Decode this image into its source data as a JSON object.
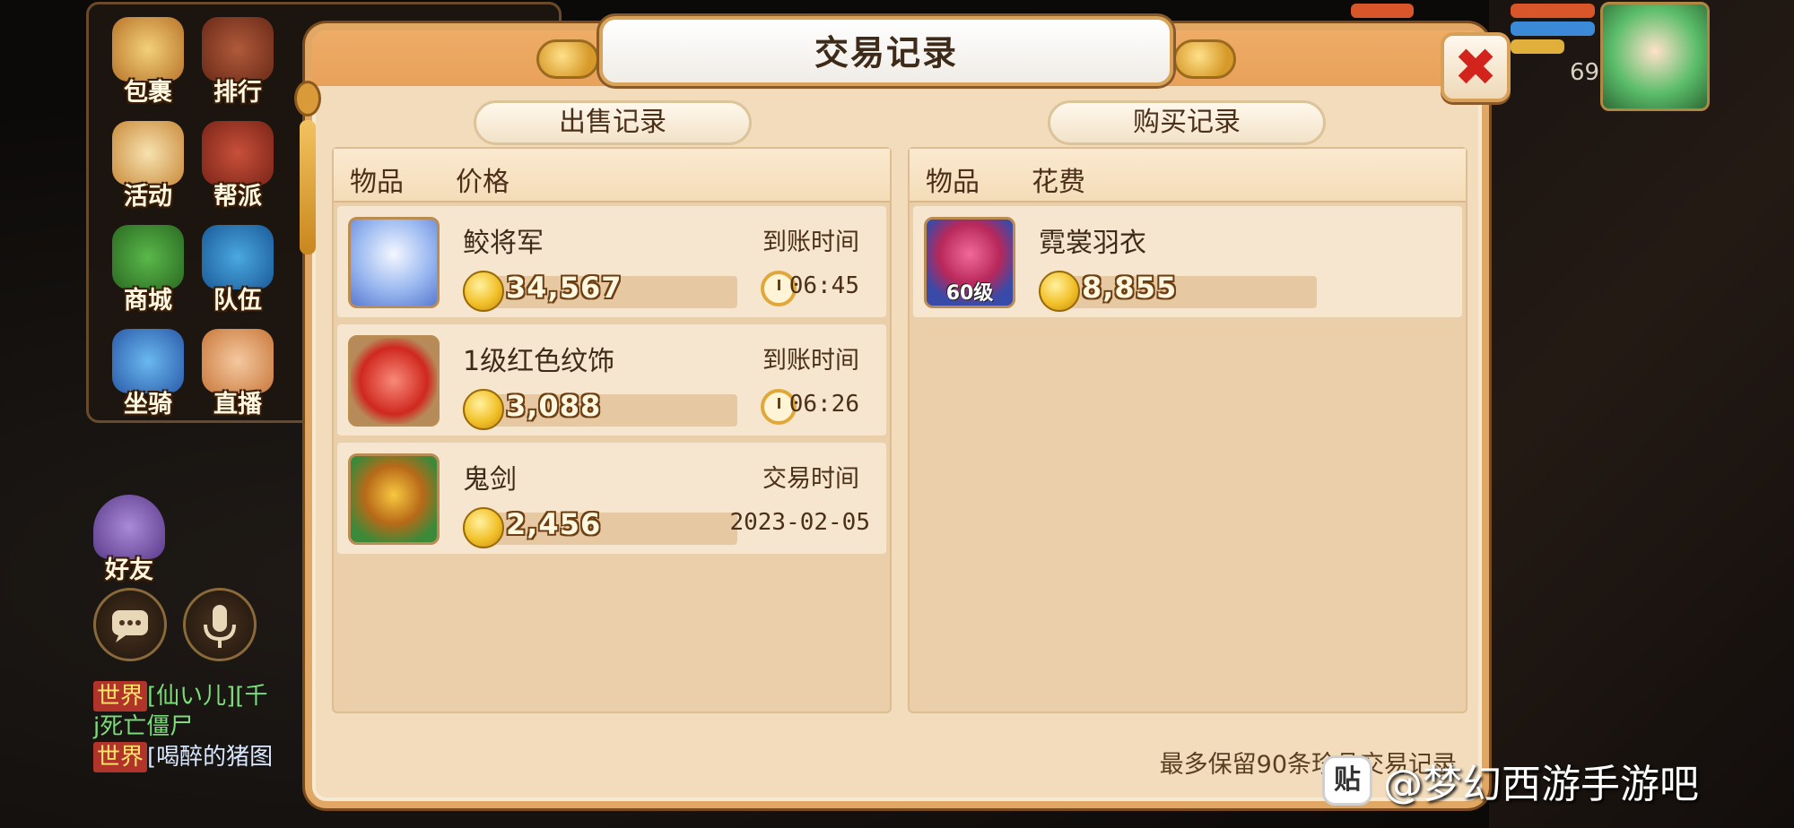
{
  "dialog": {
    "title": "交易记录",
    "close_icon": "close-x",
    "footnote": "最多保留90条珍品交易记录"
  },
  "sell": {
    "header": "出售记录",
    "columns": [
      "物品",
      "价格"
    ],
    "rows": [
      {
        "name": "鲛将军",
        "price": "34,567",
        "time_label": "到账时间",
        "time": "06:45",
        "icon": "character-portrait-icon"
      },
      {
        "name": "1级红色纹饰",
        "price": "3,088",
        "time_label": "到账时间",
        "time": "06:26",
        "icon": "red-gem-icon"
      },
      {
        "name": "鬼剑",
        "price": "2,456",
        "time_label": "交易时间",
        "time": "2023-02-05",
        "icon": "ghost-sword-icon"
      }
    ]
  },
  "buy": {
    "header": "购买记录",
    "columns": [
      "物品",
      "花费"
    ],
    "rows": [
      {
        "name": "霓裳羽衣",
        "price": "8,855",
        "level": "60级",
        "icon": "armor-icon"
      }
    ]
  },
  "menu": {
    "items": [
      "包裹",
      "排行",
      "活动",
      "帮派",
      "商城",
      "队伍",
      "坐骑",
      "直播"
    ],
    "friends": "好友"
  },
  "chat": {
    "line1_tag": "世界",
    "line1": "[仙い儿][千",
    "line2": "j死亡僵尸",
    "line3_tag": "世界",
    "line3": "[喝醉的猪图"
  },
  "hud": {
    "level": "69"
  },
  "watermark": {
    "logo": "贴",
    "text": "@梦幻西游手游吧"
  },
  "colors": {
    "dialog_bg": "#f2dcbc",
    "title_bar": "#e8a15a",
    "close_red": "#d2231c",
    "price_text": "#fff7df"
  }
}
